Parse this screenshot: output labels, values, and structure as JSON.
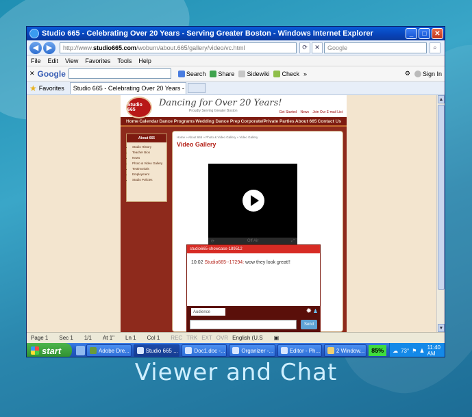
{
  "window": {
    "title": "Studio 665 - Celebrating Over 20 Years - Serving Greater Boston - Windows Internet Explorer"
  },
  "address": {
    "url_prefix": "http://www.",
    "url_domain": "studio665.com",
    "url_path": "/woburn/about.665/gallery/video/vc.html",
    "search_placeholder": "Google"
  },
  "menu": [
    "File",
    "Edit",
    "View",
    "Favorites",
    "Tools",
    "Help"
  ],
  "googlebar": {
    "logo": "Google",
    "search": "Search",
    "share": "Share",
    "sidewiki": "Sidewiki",
    "check": "Check",
    "more": "»",
    "signin": "Sign In"
  },
  "favorites": {
    "label": "Favorites",
    "tab_title": "Studio 665 - Celebrating Over 20 Years - Serving Gre..."
  },
  "site": {
    "logo": "Studio 665",
    "tagline": "Dancing for Over 20 Years!",
    "tagline_sub": "Proudly Serving Greater Boston",
    "toplinks": [
      "Get Started",
      "News",
      "Join Our E-mail List"
    ],
    "nav": [
      "Home",
      "Calendar",
      "Dance Programs",
      "Wedding Dance Prep",
      "Corporate/Private Parties",
      "About 665",
      "Contact Us"
    ],
    "about_title": "About 665",
    "about_items": [
      "Studio History",
      "Teacher Bios",
      "News",
      "Photo & Video Gallery",
      "Testimonials",
      "Employment",
      "Studio Policies"
    ],
    "breadcrumb": "Home » About 665 » Photo & Video Gallery » Video Gallery",
    "page_title": "Video Gallery",
    "video_ctrl": "Off Air",
    "chat": {
      "channel": "studio665-showcase-189512",
      "time": "10:02",
      "user": "Studio665--17294:",
      "message": "wow they look great!!",
      "audience": "Audience",
      "send": "Send"
    }
  },
  "statusbar": {
    "page": "Page 1",
    "sec": "Sec 1",
    "pages": "1/1",
    "at": "At 1\"",
    "ln": "Ln 1",
    "col": "Col 1",
    "rec": "REC",
    "trk": "TRK",
    "ext": "EXT",
    "ovr": "OVR",
    "lang": "English (U.S"
  },
  "taskbar": {
    "start": "start",
    "tasks": [
      "Adobe Dre...",
      "Studio 665 ...",
      "Doc1.doc -...",
      "Organizer -...",
      "Editor - Ph...",
      "2 Window..."
    ],
    "battery": "85%",
    "temp": "73°",
    "time": "11:40 AM"
  },
  "caption": "Viewer and Chat"
}
